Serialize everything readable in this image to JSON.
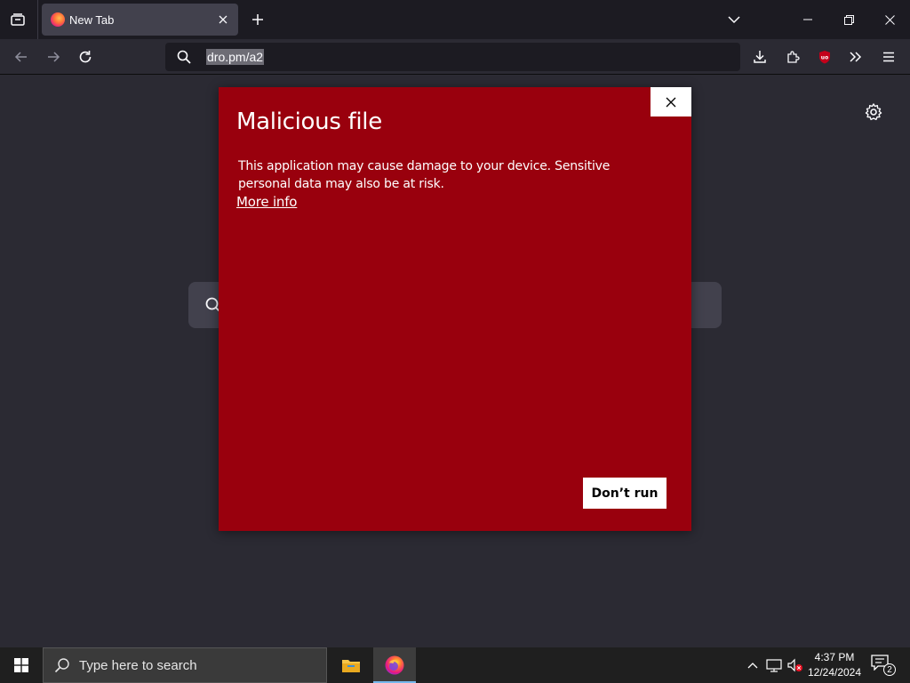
{
  "browser": {
    "tab": {
      "title": "New Tab"
    },
    "url": "dro.pm/a2"
  },
  "dialog": {
    "title": "Malicious file",
    "body": "This application may cause damage to your device. Sensitive personal data may also be at risk.",
    "more_info": "More info",
    "dont_run": "Don’t run",
    "background_color": "#99000d"
  },
  "taskbar": {
    "search_placeholder": "Type here to search",
    "time": "4:37 PM",
    "date": "12/24/2024",
    "notification_count": "2"
  },
  "icons": {
    "browser": [
      "tab-list-icon",
      "close-icon",
      "plus-icon",
      "chevron-down-icon",
      "minimize-icon",
      "restore-icon",
      "close-icon",
      "back-icon",
      "forward-icon",
      "reload-icon",
      "search-icon",
      "download-icon",
      "extensions-icon",
      "ublock-icon",
      "overflow-icon",
      "menu-icon",
      "gear-icon"
    ],
    "taskbar": [
      "windows-icon",
      "search-icon",
      "file-explorer-icon",
      "firefox-icon",
      "chevron-up-icon",
      "network-icon",
      "volume-muted-icon",
      "notification-icon"
    ]
  }
}
